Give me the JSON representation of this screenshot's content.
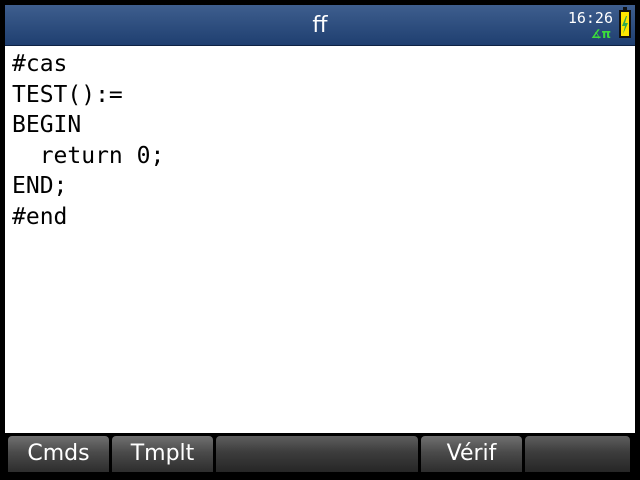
{
  "title": "ff",
  "status": {
    "time": "16:26",
    "angle_mode": "∡π",
    "battery_icon": "battery-charging-icon"
  },
  "editor": {
    "lines": [
      "#cas",
      "TEST():=",
      "BEGIN",
      "  return 0;",
      "END;",
      "#end"
    ]
  },
  "softkeys": [
    {
      "label": "Cmds"
    },
    {
      "label": "Tmplt"
    },
    {
      "label": ""
    },
    {
      "label": "Vérif"
    },
    {
      "label": ""
    }
  ],
  "colors": {
    "titlebar": "#2a4a7c",
    "angle_mode": "#3cdc3c",
    "battery": "#ffe600"
  }
}
